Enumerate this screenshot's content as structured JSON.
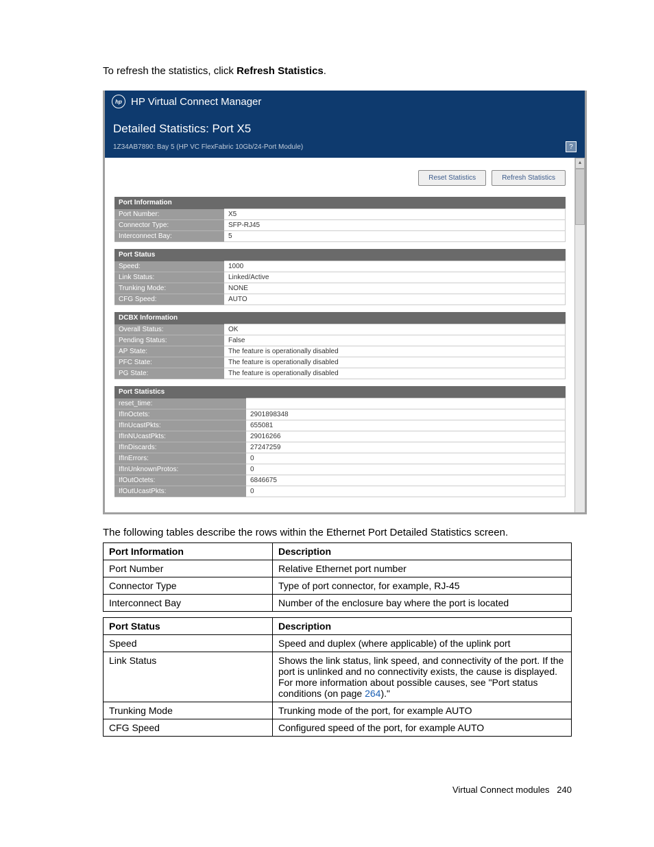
{
  "intro": {
    "prefix": "To refresh the statistics, click ",
    "bold": "Refresh Statistics",
    "suffix": "."
  },
  "screenshot": {
    "appTitle": "HP Virtual Connect Manager",
    "pageTitle": "Detailed Statistics: Port X5",
    "subtitle": "1Z34AB7890: Bay 5 (HP VC FlexFabric 10Gb/24-Port Module)",
    "helpGlyph": "?",
    "buttons": {
      "reset": "Reset Statistics",
      "refresh": "Refresh Statistics"
    },
    "sections": [
      {
        "header": "Port Information",
        "rows": [
          {
            "label": "Port Number:",
            "value": "X5"
          },
          {
            "label": "Connector Type:",
            "value": "SFP-RJ45"
          },
          {
            "label": "Interconnect Bay:",
            "value": "5"
          }
        ]
      },
      {
        "header": "Port Status",
        "rows": [
          {
            "label": "Speed:",
            "value": "1000"
          },
          {
            "label": "Link Status:",
            "value": "Linked/Active"
          },
          {
            "label": "Trunking Mode:",
            "value": "NONE"
          },
          {
            "label": "CFG Speed:",
            "value": "AUTO"
          }
        ]
      },
      {
        "header": "DCBX Information",
        "rows": [
          {
            "label": "Overall Status:",
            "value": "OK"
          },
          {
            "label": "Pending Status:",
            "value": "False"
          },
          {
            "label": "AP State:",
            "value": "The feature is operationally disabled"
          },
          {
            "label": "PFC State:",
            "value": "The feature is operationally disabled"
          },
          {
            "label": "PG State:",
            "value": "The feature is operationally disabled"
          }
        ]
      },
      {
        "header": "Port Statistics",
        "wide": true,
        "rows": [
          {
            "label": "reset_time:",
            "value": ""
          },
          {
            "label": "IfInOctets:",
            "value": "2901898348"
          },
          {
            "label": "IfInUcastPkts:",
            "value": "655081"
          },
          {
            "label": "IfInNUcastPkts:",
            "value": "29016266"
          },
          {
            "label": "IfInDiscards:",
            "value": "27247259"
          },
          {
            "label": "IfInErrors:",
            "value": "0"
          },
          {
            "label": "IfInUnknownProtos:",
            "value": "0"
          },
          {
            "label": "IfOutOctets:",
            "value": "6846675"
          },
          {
            "label": "IfOutUcastPkts:",
            "value": "0"
          }
        ]
      }
    ]
  },
  "descText": "The following tables describe the rows within the Ethernet Port Detailed Statistics screen.",
  "docTables": [
    {
      "headers": [
        "Port Information",
        "Description"
      ],
      "rows": [
        [
          "Port Number",
          "Relative Ethernet port number"
        ],
        [
          "Connector Type",
          "Type of port connector, for example, RJ-45"
        ],
        [
          "Interconnect Bay",
          "Number of the enclosure bay where the port is located"
        ]
      ]
    },
    {
      "headers": [
        "Port Status",
        "Description"
      ],
      "rows": [
        [
          "Speed",
          "Speed and duplex (where applicable) of the uplink port"
        ],
        [
          "Link Status",
          {
            "text": "Shows the link status, link speed, and connectivity of the port. If the port is unlinked and no connectivity exists, the cause is displayed. For more information about possible causes, see \"Port status conditions (on page ",
            "link": "264",
            "after": ").\""
          }
        ],
        [
          "Trunking Mode",
          "Trunking mode of the port, for example AUTO"
        ],
        [
          "CFG Speed",
          "Configured speed of the port, for example AUTO"
        ]
      ]
    }
  ],
  "footer": {
    "section": "Virtual Connect modules",
    "page": "240"
  }
}
